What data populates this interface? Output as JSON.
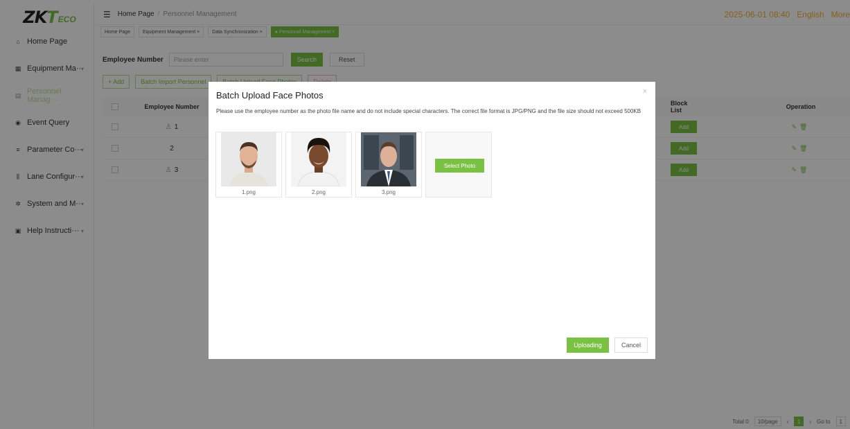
{
  "brand": {
    "logo_zk": "ZK",
    "logo_t": "T",
    "logo_eco": "ECO"
  },
  "sidebar": {
    "items": [
      {
        "label": "Home Page",
        "icon": "home-icon"
      },
      {
        "label": "Equipment Ma···",
        "icon": "device-icon"
      },
      {
        "label": "Personnel Manag···",
        "icon": "personnel-icon"
      },
      {
        "label": "Event Query",
        "icon": "event-icon"
      },
      {
        "label": "Parameter Co···",
        "icon": "parameter-icon"
      },
      {
        "label": "Lane Configur···",
        "icon": "lane-icon"
      },
      {
        "label": "System and M···",
        "icon": "system-icon"
      },
      {
        "label": "Help Instructi···",
        "icon": "help-icon"
      }
    ]
  },
  "topbar": {
    "breadcrumb_home": "Home Page",
    "breadcrumb_sep": "/",
    "breadcrumb_current": "Personnel Management",
    "datetime": "2025-06-01 08:40",
    "language": "English",
    "more": "More"
  },
  "tabs": [
    {
      "label": "Home Page"
    },
    {
      "label": "Equipment Management ×"
    },
    {
      "label": "Data Synchronization ×"
    },
    {
      "label": "● Personnel Management ×"
    }
  ],
  "search": {
    "label": "Employee Number",
    "placeholder": "Please enter",
    "search_btn": "Search",
    "reset_btn": "Reset"
  },
  "actions": {
    "add": "+ Add",
    "batch_import": "Batch Import Personnel",
    "batch_upload": "Batch Upload Face Photos",
    "delete": "Delete"
  },
  "table": {
    "headers": {
      "employee_number": "Employee Number",
      "block_list": "Block List",
      "operation": "Operation"
    },
    "rows": [
      {
        "employee_number": "1",
        "add": "Add"
      },
      {
        "employee_number": "2",
        "add": "Add"
      },
      {
        "employee_number": "3",
        "add": "Add"
      }
    ]
  },
  "pager": {
    "total": "Total 0",
    "page_size": "10/page",
    "current": "1",
    "goto": "Go to",
    "goto_value": "1"
  },
  "modal": {
    "title": "Batch Upload Face Photos",
    "close": "×",
    "description": "Please use the employee number as the photo file name and do not include special characters. The correct file format is JPG/PNG and the file size should not exceed 500KB",
    "photos": [
      {
        "name": "1.png"
      },
      {
        "name": "2.png"
      },
      {
        "name": "3.png"
      }
    ],
    "select_photo": "Select Photo",
    "upload_btn": "Uploading",
    "cancel_btn": "Cancel"
  },
  "colors": {
    "accent": "#7ac143",
    "overlay": "rgba(0,0,0,0.45)"
  }
}
